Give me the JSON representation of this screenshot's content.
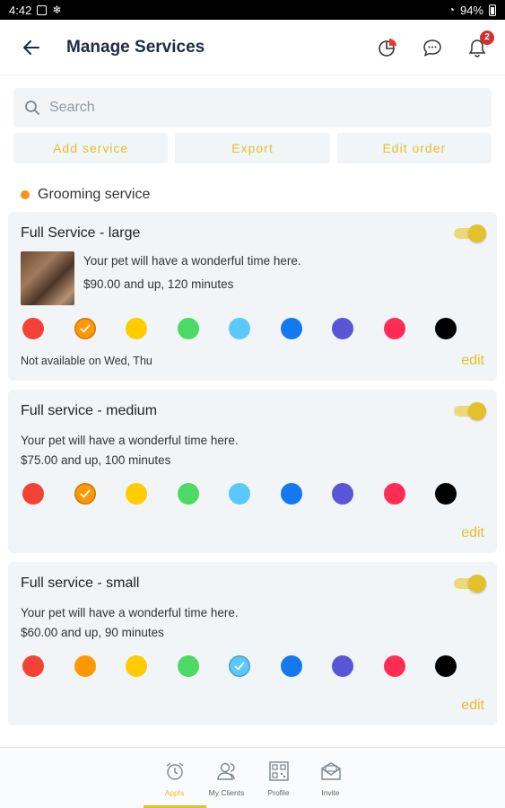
{
  "status_bar": {
    "time": "4:42",
    "battery": "94%"
  },
  "header": {
    "title": "Manage Services",
    "notification_count": "2"
  },
  "search": {
    "placeholder": "Search"
  },
  "actions": {
    "add": "Add service",
    "export": "Export",
    "edit_order": "Edit order"
  },
  "section": {
    "title": "Grooming service"
  },
  "colors": [
    "#f44336",
    "#ff9800",
    "#ffcc00",
    "#4cd964",
    "#5ac8fa",
    "#1479ee",
    "#5856d6",
    "#ff2d55",
    "#000000"
  ],
  "services": [
    {
      "title": "Full Service - large",
      "desc": "Your pet will have a wonderful time here.",
      "price": "$90.00 and up, 120 minutes",
      "availability": "Not available on Wed, Thu",
      "selected_color": 1,
      "enabled": true,
      "edit": "edit"
    },
    {
      "title": "Full service - medium",
      "desc": "Your pet will have a wonderful time here.",
      "price": "$75.00 and up, 100 minutes",
      "availability": "",
      "selected_color": 1,
      "enabled": true,
      "edit": "edit"
    },
    {
      "title": "Full service - small",
      "desc": "Your pet will have a wonderful time here.",
      "price": "$60.00 and up, 90 minutes",
      "availability": "",
      "selected_color": 4,
      "enabled": true,
      "edit": "edit"
    }
  ],
  "nav": [
    {
      "label": "Appts",
      "icon": "alarm-clock-icon",
      "active": true
    },
    {
      "label": "My Clients",
      "icon": "clients-icon",
      "active": false
    },
    {
      "label": "Profile",
      "icon": "profile-icon",
      "active": false
    },
    {
      "label": "Invite",
      "icon": "invite-icon",
      "active": false
    }
  ]
}
